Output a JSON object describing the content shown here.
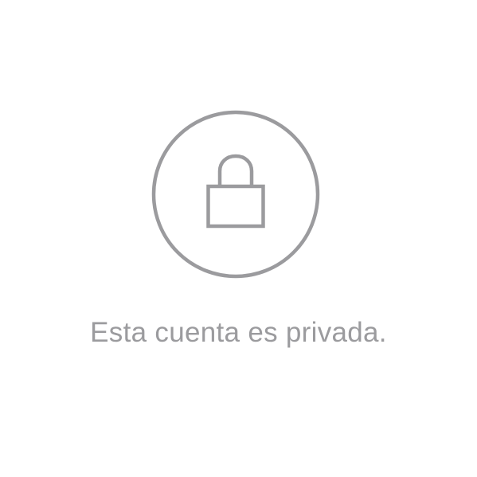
{
  "colors": {
    "background": "#ffffff",
    "icon_stroke": "#9b9b9e",
    "text": "#9b9b9e"
  },
  "icons": {
    "badge": "circle-outline",
    "lock": "lock-icon"
  },
  "message": {
    "text": "Esta cuenta es privada."
  }
}
